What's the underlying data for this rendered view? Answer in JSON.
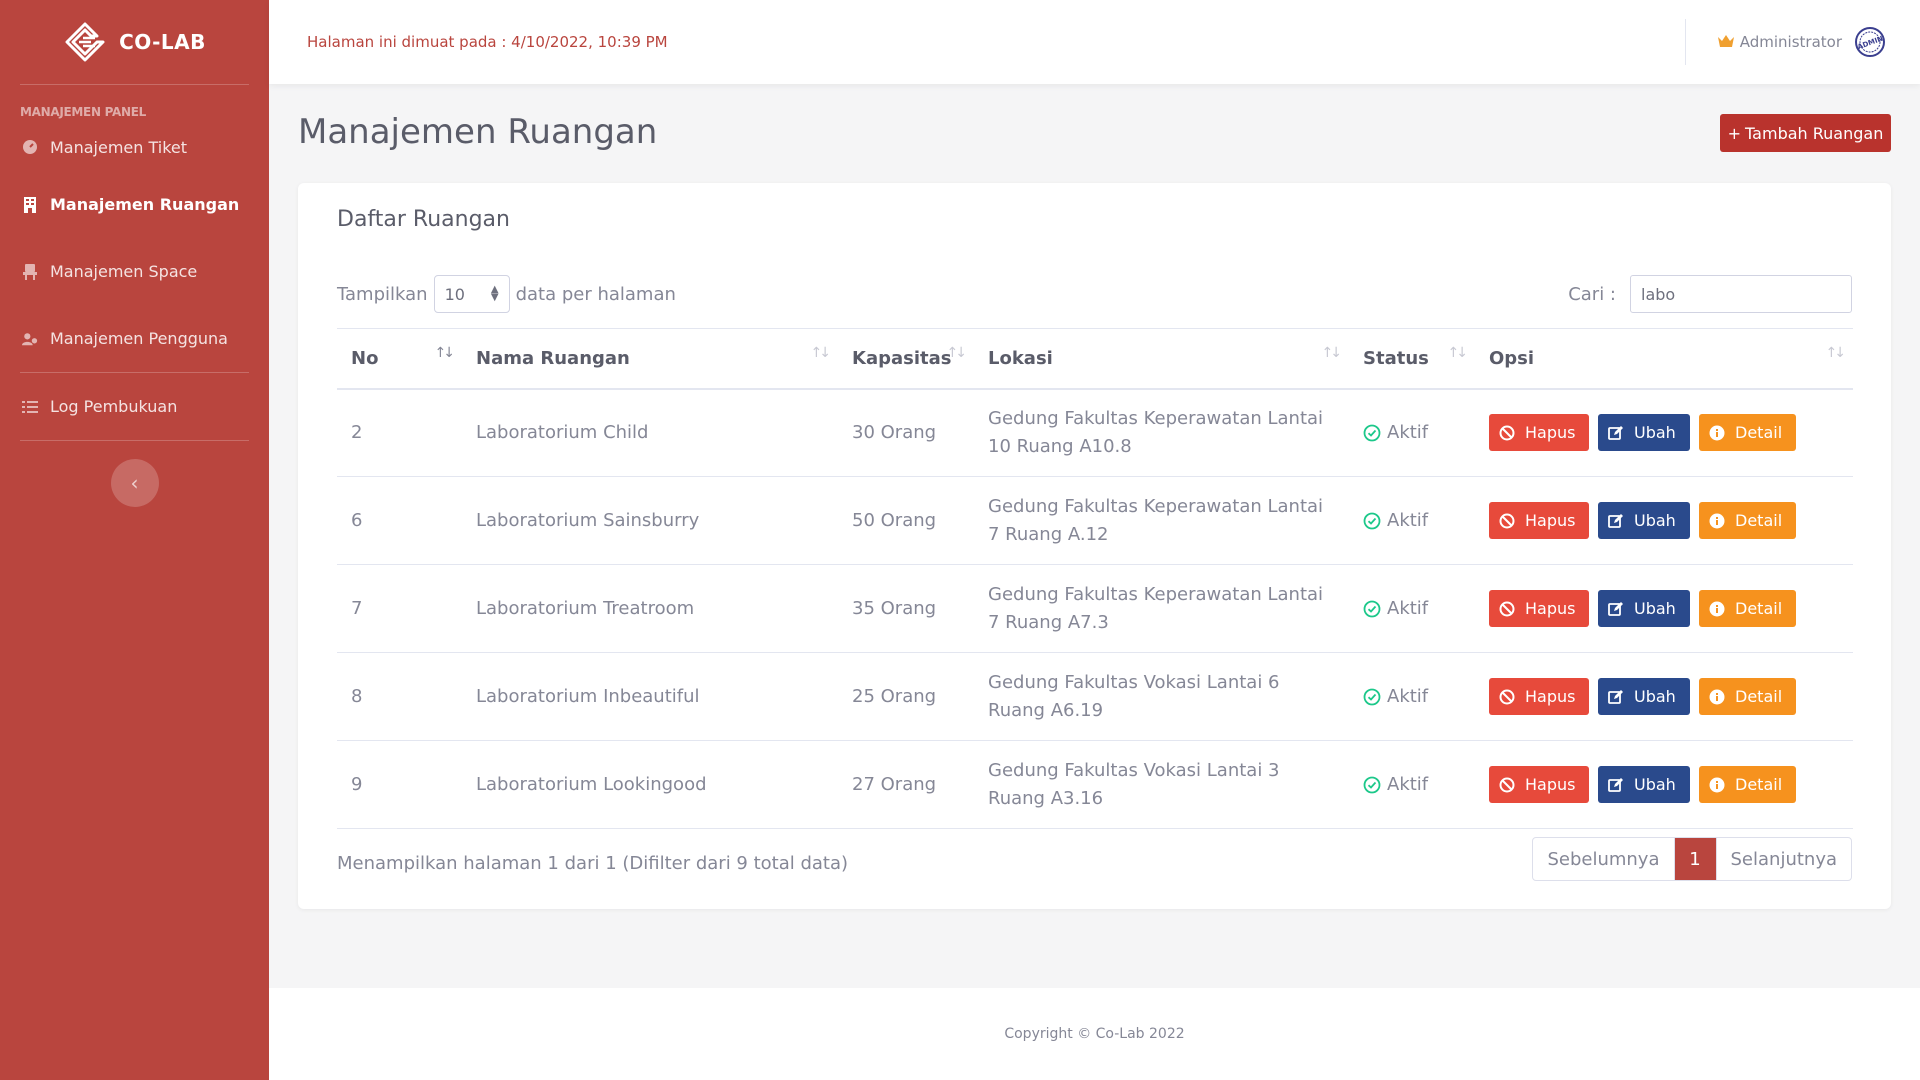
{
  "brand": {
    "name": "CO-LAB",
    "logo": "colab-logo"
  },
  "sidebar": {
    "heading": "MANAJEMEN PANEL",
    "items": [
      {
        "label": "Manajemen Tiket",
        "icon": "ticket-icon",
        "active": false
      },
      {
        "label": "Manajemen Ruangan",
        "icon": "building-icon",
        "active": true
      },
      {
        "label": "Manajemen Space",
        "icon": "chair-icon",
        "active": false
      },
      {
        "label": "Manajemen Pengguna",
        "icon": "users-icon",
        "active": false
      },
      {
        "label": "Log Pembukuan",
        "icon": "list-icon",
        "active": false
      }
    ],
    "toggle_icon": "chevron-left-icon"
  },
  "topbar": {
    "loaded_text": "Halaman ini dimuat pada : 4/10/2022, 10:39 PM",
    "user_name": "Administrator",
    "user_icon": "crown-icon",
    "avatar_text": "ADMIN"
  },
  "page": {
    "title": "Manajemen Ruangan",
    "add_button": "Tambah Ruangan"
  },
  "card": {
    "title": "Daftar Ruangan",
    "length_prefix": "Tampilkan",
    "length_value": "10",
    "length_suffix": "data per halaman",
    "search_label": "Cari :",
    "search_value": "labo"
  },
  "table": {
    "columns": [
      "No",
      "Nama Ruangan",
      "Kapasitas",
      "Lokasi",
      "Status",
      "Opsi"
    ],
    "rows": [
      {
        "no": "2",
        "nama": "Laboratorium Child",
        "kapasitas": "30 Orang",
        "lokasi": "Gedung Fakultas Keperawatan Lantai 10 Ruang A10.8",
        "status": "Aktif"
      },
      {
        "no": "6",
        "nama": "Laboratorium Sainsburry",
        "kapasitas": "50 Orang",
        "lokasi": "Gedung Fakultas Keperawatan Lantai 7 Ruang A.12",
        "status": "Aktif"
      },
      {
        "no": "7",
        "nama": "Laboratorium Treatroom",
        "kapasitas": "35 Orang",
        "lokasi": "Gedung Fakultas Keperawatan Lantai 7 Ruang A7.3",
        "status": "Aktif"
      },
      {
        "no": "8",
        "nama": "Laboratorium Inbeautiful",
        "kapasitas": "25 Orang",
        "lokasi": "Gedung Fakultas Vokasi Lantai 6 Ruang A6.19",
        "status": "Aktif"
      },
      {
        "no": "9",
        "nama": "Laboratorium Lookingood",
        "kapasitas": "27 Orang",
        "lokasi": "Gedung Fakultas Vokasi Lantai 3 Ruang A3.16",
        "status": "Aktif"
      }
    ],
    "actions": {
      "delete": "Hapus",
      "edit": "Ubah",
      "detail": "Detail"
    }
  },
  "footer_info": "Menampilkan halaman 1 dari 1 (Difilter dari 9 total data)",
  "pagination": {
    "prev": "Sebelumnya",
    "current": "1",
    "next": "Selanjutnya"
  },
  "footer": {
    "copyright": "Copyright © Co-Lab 2022"
  },
  "colors": {
    "primary": "#b9453e",
    "danger": "#e74a3b",
    "edit": "#2a4a8c",
    "warning": "#f6921e",
    "success": "#1cc88a"
  }
}
